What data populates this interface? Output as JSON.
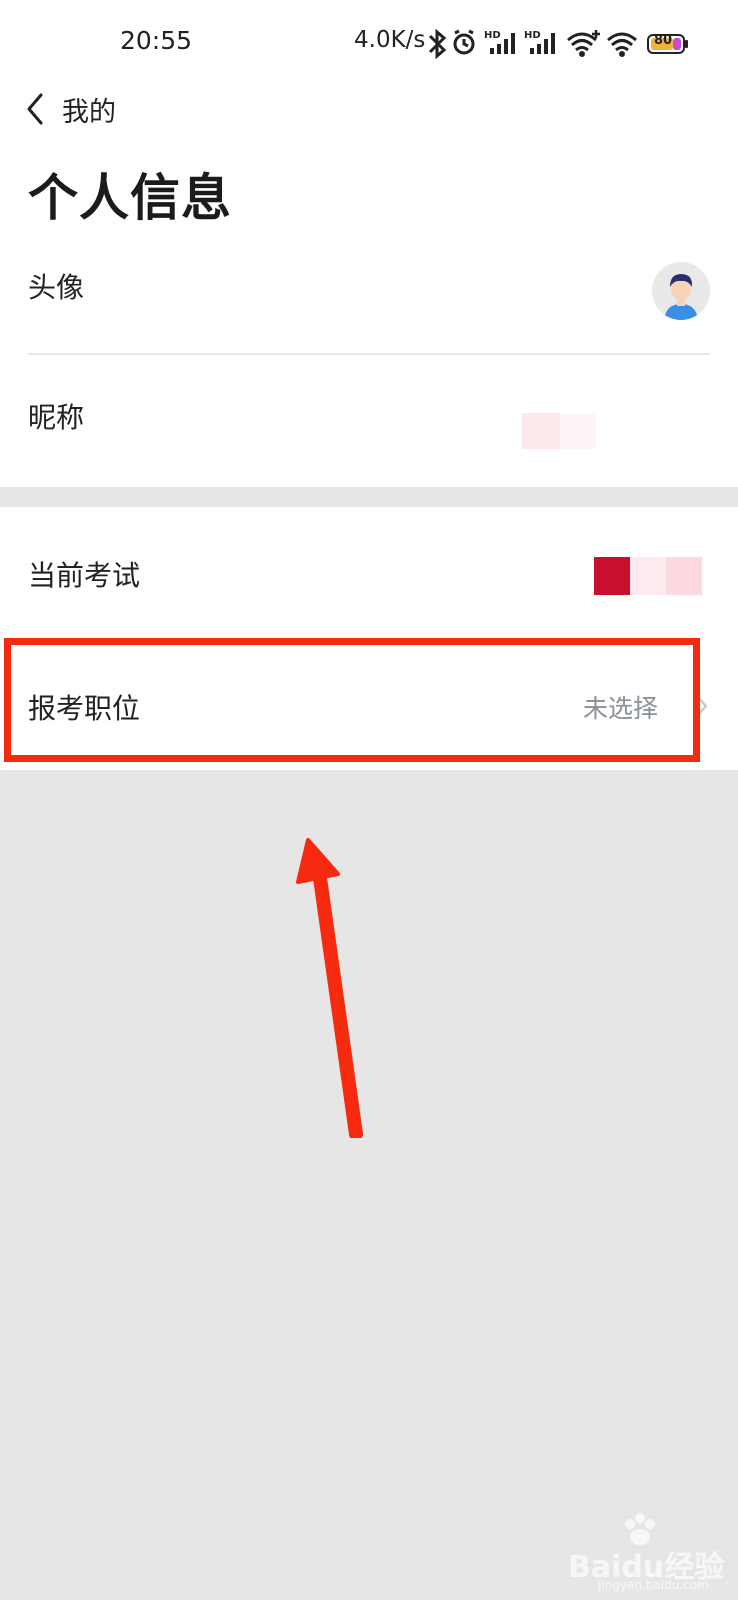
{
  "status_bar": {
    "time": "20:55",
    "network_speed": "4.0K/s",
    "battery": "80",
    "icons": [
      "bluetooth-icon",
      "alarm-icon",
      "signal-hd-icon",
      "signal-hd-icon",
      "wifi-plus-icon",
      "wifi-icon",
      "battery-icon"
    ]
  },
  "header": {
    "back_label": "我的",
    "title": "个人信息"
  },
  "profile": {
    "avatar_label": "头像",
    "nickname_label": "昵称"
  },
  "exam": {
    "current_exam_label": "当前考试",
    "position_label": "报考职位",
    "position_value": "未选择"
  },
  "watermark": {
    "text": "Baidu经验",
    "sub": "jingyan.baidu.com"
  },
  "colors": {
    "highlight": "#f52a0e",
    "accent_red": "#c8102e",
    "avatar_shirt": "#3a8ee6"
  }
}
